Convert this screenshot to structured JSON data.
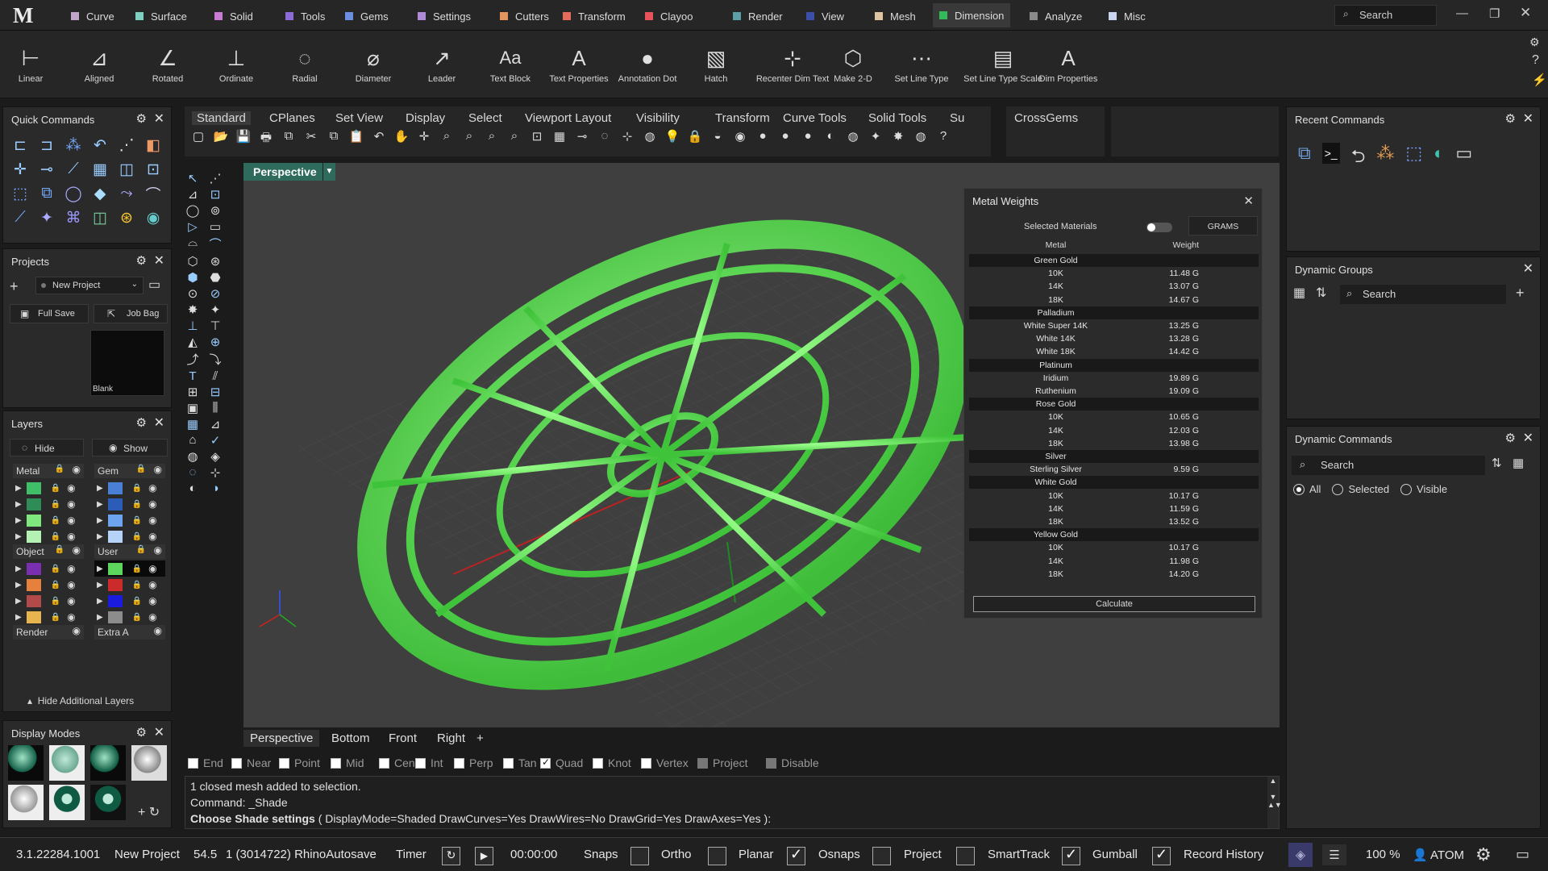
{
  "menu": {
    "tabs": [
      {
        "label": "Curve",
        "color": "#c2a3c9"
      },
      {
        "label": "Surface",
        "color": "#7ed0c2"
      },
      {
        "label": "Solid",
        "color": "#c97ad1"
      },
      {
        "label": "Tools",
        "color": "#8c6bd6"
      },
      {
        "label": "Gems",
        "color": "#6a8fe0"
      },
      {
        "label": "Settings",
        "color": "#b08ad6"
      },
      {
        "label": "Cutters",
        "color": "#e3955f"
      },
      {
        "label": "Transform",
        "color": "#e56b5c"
      },
      {
        "label": "Clayoo",
        "color": "#e6535a"
      },
      {
        "label": "Render",
        "color": "#5c9fa6"
      },
      {
        "label": "View",
        "color": "#3b4fa8"
      },
      {
        "label": "Mesh",
        "color": "#e0c4a2"
      },
      {
        "label": "Dimension",
        "color": "#33b85a"
      },
      {
        "label": "Analyze",
        "color": "#8a8a8a"
      },
      {
        "label": "Misc",
        "color": "#c9d4f0"
      }
    ],
    "search_placeholder": "Search"
  },
  "ribbon": {
    "buttons": [
      "Linear",
      "Aligned",
      "Rotated",
      "Ordinate",
      "Radial",
      "Diameter",
      "Leader",
      "Text Block",
      "Text Properties",
      "Annotation Dot",
      "Hatch",
      "Recenter Dim Text",
      "Make 2-D",
      "Set Line Type",
      "Set Line Type Scale",
      "Dim Properties"
    ]
  },
  "quick_commands": {
    "title": "Quick Commands"
  },
  "projects": {
    "title": "Projects",
    "project_name": "New Project",
    "full_save": "Full Save",
    "job_bag": "Job Bag",
    "thumb_label": "Blank"
  },
  "layers": {
    "title": "Layers",
    "hide": "Hide",
    "show": "Show",
    "groups": [
      "Metal",
      "Gem",
      "Object",
      "User",
      "Render",
      "Extra A"
    ],
    "hide_additional": "Hide Additional Layers"
  },
  "display_modes": {
    "title": "Display Modes"
  },
  "toolbar_tabs": [
    "Standard",
    "CPlanes",
    "Set View",
    "Display",
    "Select",
    "Viewport Layout",
    "Visibility",
    "Transform",
    "Curve Tools",
    "Solid Tools",
    "Su"
  ],
  "crossgems_tab": "CrossGems",
  "viewport": {
    "active": "Perspective",
    "tabs": [
      "Perspective",
      "Bottom",
      "Front",
      "Right",
      "+"
    ]
  },
  "osnaps": [
    {
      "label": "End",
      "on": false
    },
    {
      "label": "Near",
      "on": false
    },
    {
      "label": "Point",
      "on": false
    },
    {
      "label": "Mid",
      "on": false
    },
    {
      "label": "Cen",
      "on": false
    },
    {
      "label": "Int",
      "on": false
    },
    {
      "label": "Perp",
      "on": false
    },
    {
      "label": "Tan",
      "on": false
    },
    {
      "label": "Quad",
      "on": true
    },
    {
      "label": "Knot",
      "on": false
    },
    {
      "label": "Vertex",
      "on": false
    },
    {
      "label": "Project",
      "on": false
    },
    {
      "label": "Disable",
      "on": false
    }
  ],
  "command": {
    "line1": "1 closed mesh added to selection.",
    "line2": "Command: _Shade",
    "prompt_bold": "Choose Shade settings",
    "prompt_rest": " ( DisplayMode=Shaded  DrawCurves=Yes  DrawWires=No  DrawGrid=Yes  DrawAxes=Yes ):"
  },
  "metal_weights": {
    "title": "Metal Weights",
    "selected_materials": "Selected Materials",
    "unit": "GRAMS",
    "col_metal": "Metal",
    "col_weight": "Weight",
    "rows": [
      {
        "g": "Green Gold"
      },
      {
        "m": "10K",
        "w": "11.48 G"
      },
      {
        "m": "14K",
        "w": "13.07 G"
      },
      {
        "m": "18K",
        "w": "14.67 G"
      },
      {
        "g": "Palladium"
      },
      {
        "m": "White Super 14K",
        "w": "13.25 G"
      },
      {
        "m": "White 14K",
        "w": "13.28 G"
      },
      {
        "m": "White 18K",
        "w": "14.42 G"
      },
      {
        "g": "Platinum"
      },
      {
        "m": "Iridium",
        "w": "19.89 G"
      },
      {
        "m": "Ruthenium",
        "w": "19.09 G"
      },
      {
        "g": "Rose Gold"
      },
      {
        "m": "10K",
        "w": "10.65 G"
      },
      {
        "m": "14K",
        "w": "12.03 G"
      },
      {
        "m": "18K",
        "w": "13.98 G"
      },
      {
        "g": "Silver"
      },
      {
        "m": "Sterling Silver",
        "w": "9.59 G"
      },
      {
        "g": "White Gold"
      },
      {
        "m": "10K",
        "w": "10.17 G"
      },
      {
        "m": "14K",
        "w": "11.59 G"
      },
      {
        "m": "18K",
        "w": "13.52 G"
      },
      {
        "g": "Yellow Gold"
      },
      {
        "m": "10K",
        "w": "10.17 G"
      },
      {
        "m": "14K",
        "w": "11.98 G"
      },
      {
        "m": "18K",
        "w": "14.20 G"
      }
    ],
    "calculate": "Calculate"
  },
  "recent_commands": {
    "title": "Recent Commands"
  },
  "dynamic_groups": {
    "title": "Dynamic Groups",
    "search": "Search"
  },
  "dynamic_commands": {
    "title": "Dynamic Commands",
    "search": "Search",
    "radios": [
      "All",
      "Selected",
      "Visible"
    ]
  },
  "status": {
    "version": "3.1.22284.1001",
    "project": "New Project",
    "value": "54.5",
    "autosave": "1 (3014722) RhinoAutosave",
    "timer": "Timer",
    "time": "00:00:00",
    "snaps": "Snaps",
    "ortho": "Ortho",
    "planar": "Planar",
    "osnaps": "Osnaps",
    "project_label": "Project",
    "smarttrack": "SmartTrack",
    "gumball": "Gumball",
    "record_history": "Record History",
    "zoom": "100 %",
    "user": "ATOM"
  }
}
